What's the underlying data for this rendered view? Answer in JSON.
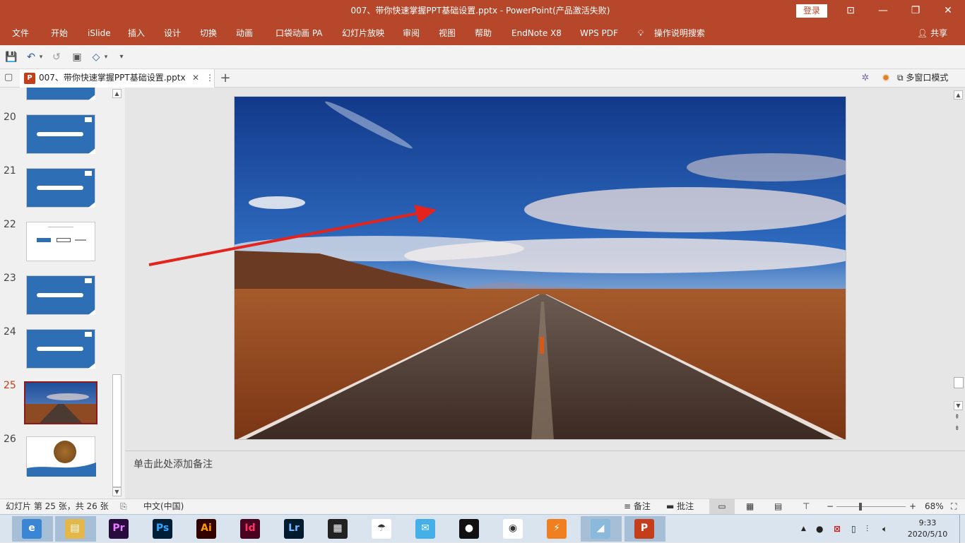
{
  "window": {
    "title": "007、带你快速掌握PPT基础设置.pptx  -  PowerPoint(产品激活失败)",
    "login_label": "登录",
    "btn_ribbon_display": "⊡",
    "btn_minimize": "—",
    "btn_restore": "❐",
    "btn_close": "✕"
  },
  "ribbon": {
    "tabs": [
      "文件",
      "开始",
      "iSlide",
      "插入",
      "设计",
      "切换",
      "动画",
      "口袋动画 PA",
      "幻灯片放映",
      "审阅",
      "视图",
      "帮助",
      "EndNote X8",
      "WPS PDF"
    ],
    "tell_me": "操作说明搜索",
    "share": "共享"
  },
  "qat": {
    "save": "💾",
    "undo": "↶",
    "repeat": "↺",
    "present": "▣",
    "shape": "◇",
    "more": "▾"
  },
  "doc_tab": {
    "label": "007、带你快速掌握PPT基础设置.pptx",
    "close": "✕",
    "menu": "⋮",
    "add": "+",
    "multi_window": "多窗口模式"
  },
  "slides": {
    "numbers": [
      "20",
      "21",
      "22",
      "23",
      "24",
      "25",
      "26"
    ],
    "selected": "25",
    "colors": {
      "selected_number": "#c43e1c",
      "thumb_blue": "#2e6eb5",
      "accent": "#b7472a"
    }
  },
  "notes": {
    "placeholder": "单击此处添加备注"
  },
  "status": {
    "slide_info": "幻灯片 第 25 张，共 26 张",
    "language": "中文(中国)",
    "notes_btn": "备注",
    "comments_btn": "批注",
    "zoom_minus": "−",
    "zoom_plus": "+",
    "zoom": "68%",
    "zoom_fraction": 0.34
  },
  "taskbar": {
    "apps": [
      {
        "name": "browser-360",
        "label": "e",
        "color": "#3b86d4"
      },
      {
        "name": "file-explorer",
        "label": "▤",
        "color": "#e4b74a"
      },
      {
        "name": "premiere",
        "label": "Pr",
        "color": "#2a0b3d"
      },
      {
        "name": "photoshop",
        "label": "Ps",
        "color": "#001e36"
      },
      {
        "name": "illustrator",
        "label": "Ai",
        "color": "#330000"
      },
      {
        "name": "indesign",
        "label": "Id",
        "color": "#49021f"
      },
      {
        "name": "lightroom",
        "label": "Lr",
        "color": "#001a2e"
      },
      {
        "name": "video-editor",
        "label": "▦",
        "color": "#222222"
      },
      {
        "name": "umbrella-app",
        "label": "☂",
        "color": "#ffffff"
      },
      {
        "name": "chat-bird",
        "label": "✉",
        "color": "#45b0e8"
      },
      {
        "name": "qq",
        "label": "●",
        "color": "#111111"
      },
      {
        "name": "chrome",
        "label": "◉",
        "color": "#ffffff"
      },
      {
        "name": "thunder",
        "label": "⚡",
        "color": "#f0801f"
      },
      {
        "name": "notes-app",
        "label": "◢",
        "color": "#8ab9dc"
      },
      {
        "name": "powerpoint",
        "label": "P",
        "color": "#c43e1c"
      }
    ],
    "time": "9:33",
    "date": "2020/5/10"
  }
}
